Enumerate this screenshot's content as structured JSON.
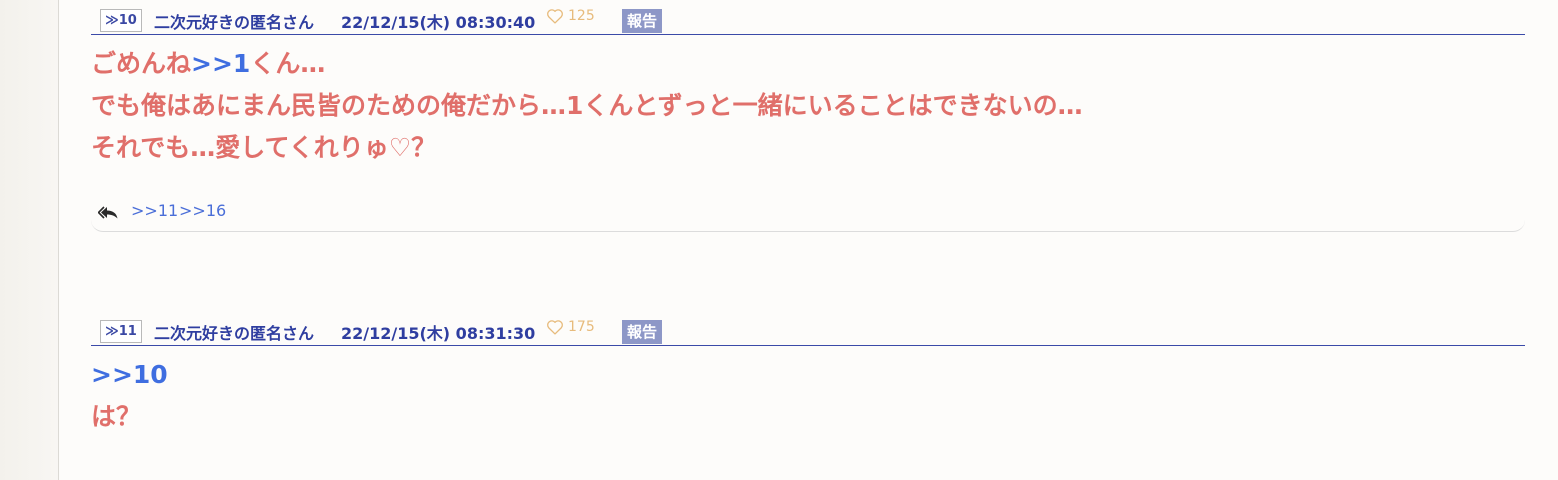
{
  "posts": [
    {
      "number": "≫10",
      "author": "二次元好きの匿名さん",
      "datetime": "22/12/15(木) 08:30:40",
      "likes": "125",
      "report_label": "報告",
      "lines": [
        {
          "a": "ごめんね",
          "b": ">>1",
          "c": "くん…"
        },
        {
          "a": "でも俺はあにまん民皆のための俺だから…1くんとずっと一緒にいることはできないの…"
        },
        {
          "a": "それでも…愛してくれりゅ♡？"
        }
      ],
      "replies": [
        ">>11",
        ">>16"
      ]
    },
    {
      "number": "≫11",
      "author": "二次元好きの匿名さん",
      "datetime": "22/12/15(木) 08:31:30",
      "likes": "175",
      "report_label": "報告",
      "lines": [
        {
          "b": ">>10"
        },
        {
          "a": "は？"
        }
      ]
    }
  ],
  "colors": {
    "author": "#2f3ea0",
    "body_text": "#e06f6a",
    "anchor": "#3f6ee0",
    "like": "#e7bb7c",
    "report_bg": "#8d97c7"
  },
  "icons": {
    "like": "heart-outline-icon",
    "reply": "reply-all-icon"
  }
}
